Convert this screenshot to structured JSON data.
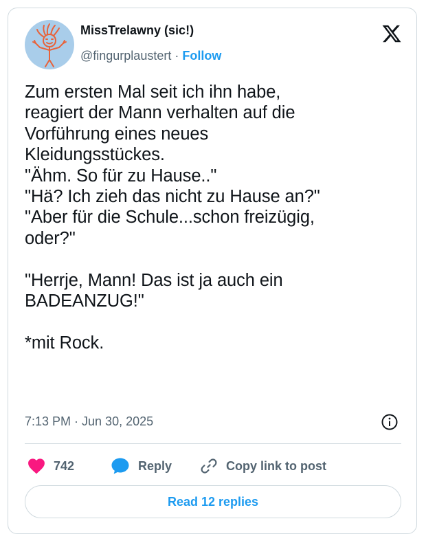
{
  "author": {
    "display_name": "MissTrelawny (sic!)",
    "handle": "@fingurplaustert",
    "separator": "·",
    "follow_label": "Follow",
    "avatar_icon": "stick-figure-avatar-icon"
  },
  "brand": {
    "icon": "x-logo-icon"
  },
  "post": {
    "text": "Zum ersten Mal seit ich ihn habe,\nreagiert der Mann verhalten auf die\nVorführung eines neues\nKleidungsstückes.\n\"Ähm. So für zu Hause..\"\n\"Hä? Ich zieh das nicht zu Hause an?\"\n\"Aber für die Schule...schon freizügig,\noder?\"\n\n\"Herrje, Mann! Das ist ja auch ein\nBADEANZUG!\"\n\n*mit Rock.",
    "timestamp": "7:13 PM · Jun 30, 2025",
    "info_icon": "info-icon"
  },
  "actions": {
    "likes": "742",
    "like_icon": "heart-icon",
    "reply_label": "Reply",
    "reply_icon": "speech-bubble-icon",
    "copy_label": "Copy link to post",
    "copy_icon": "link-icon"
  },
  "replies_button": {
    "label": "Read 12 replies"
  },
  "colors": {
    "accent": "#1d9bf0",
    "like": "#f91880",
    "muted": "#536471",
    "text": "#0f1419"
  }
}
